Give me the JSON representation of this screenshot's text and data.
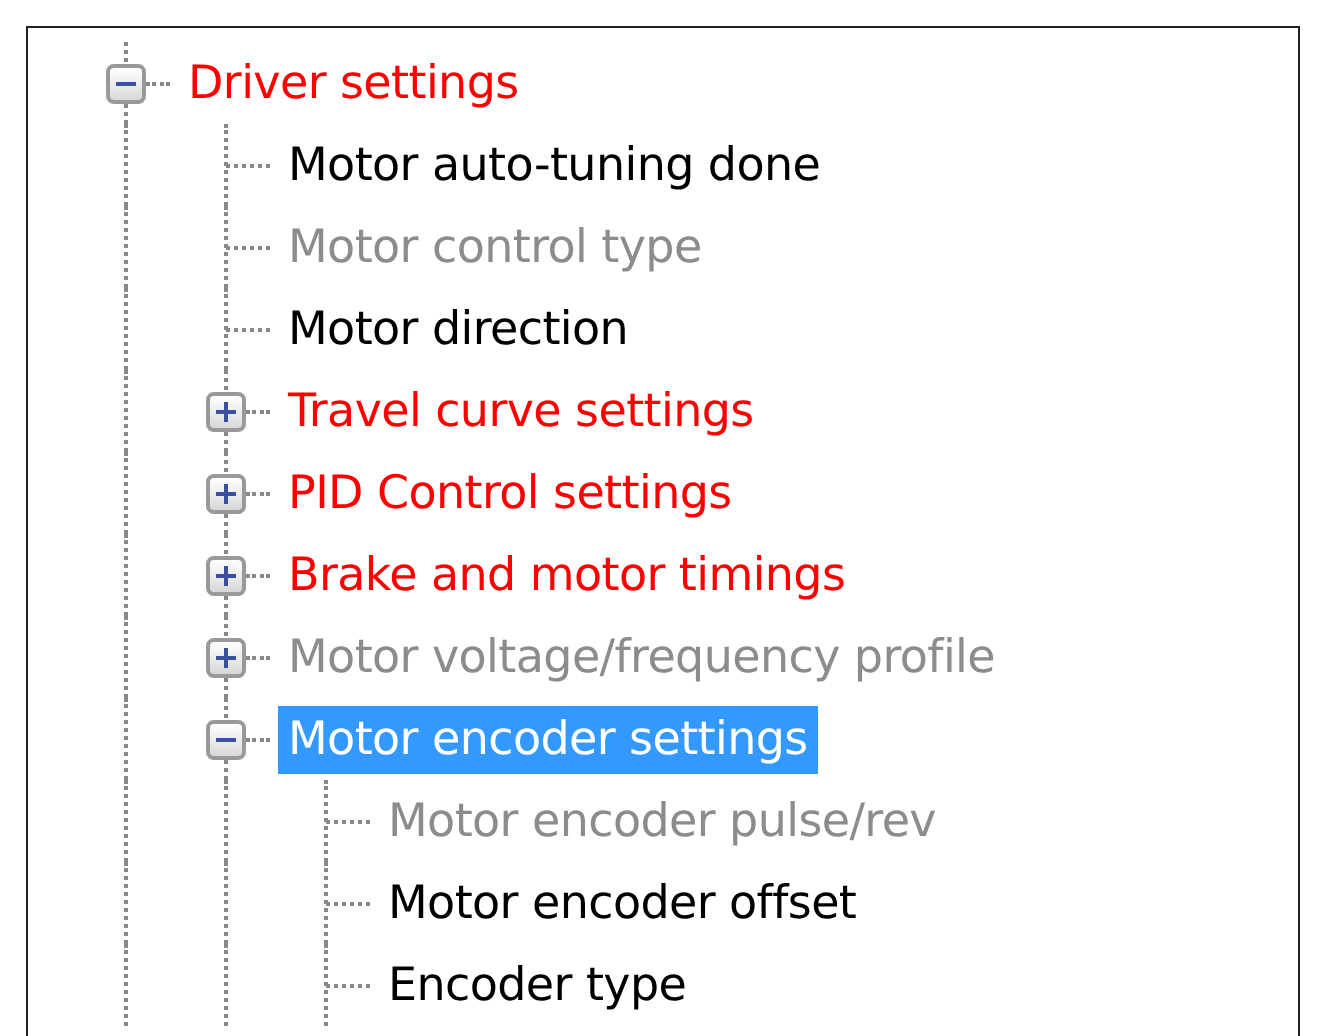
{
  "tree": [
    {
      "label": "Driver settings",
      "kind": "folder",
      "expanded": true,
      "selected": false,
      "color": "#ff0000",
      "children": [
        {
          "label": "Motor auto-tuning done",
          "kind": "leaf",
          "selected": false,
          "color": "#000000"
        },
        {
          "label": "Motor control type",
          "kind": "leaf",
          "selected": false,
          "color": "#8c8c8c"
        },
        {
          "label": "Motor direction",
          "kind": "leaf",
          "selected": false,
          "color": "#000000"
        },
        {
          "label": "Travel curve settings",
          "kind": "folder",
          "expanded": false,
          "selected": false,
          "color": "#ff0000"
        },
        {
          "label": "PID Control settings",
          "kind": "folder",
          "expanded": false,
          "selected": false,
          "color": "#ff0000"
        },
        {
          "label": "Brake and motor timings",
          "kind": "folder",
          "expanded": false,
          "selected": false,
          "color": "#ff0000"
        },
        {
          "label": "Motor voltage/frequency profile",
          "kind": "folder",
          "expanded": false,
          "selected": false,
          "color": "#8c8c8c"
        },
        {
          "label": "Motor encoder settings",
          "kind": "folder",
          "expanded": true,
          "selected": true,
          "children": [
            {
              "label": "Motor encoder pulse/rev",
              "kind": "leaf",
              "selected": false,
              "color": "#8c8c8c"
            },
            {
              "label": "Motor encoder offset",
              "kind": "leaf",
              "selected": false,
              "color": "#000000"
            },
            {
              "label": "Encoder type",
              "kind": "leaf",
              "selected": false,
              "color": "#000000"
            }
          ]
        }
      ]
    }
  ]
}
